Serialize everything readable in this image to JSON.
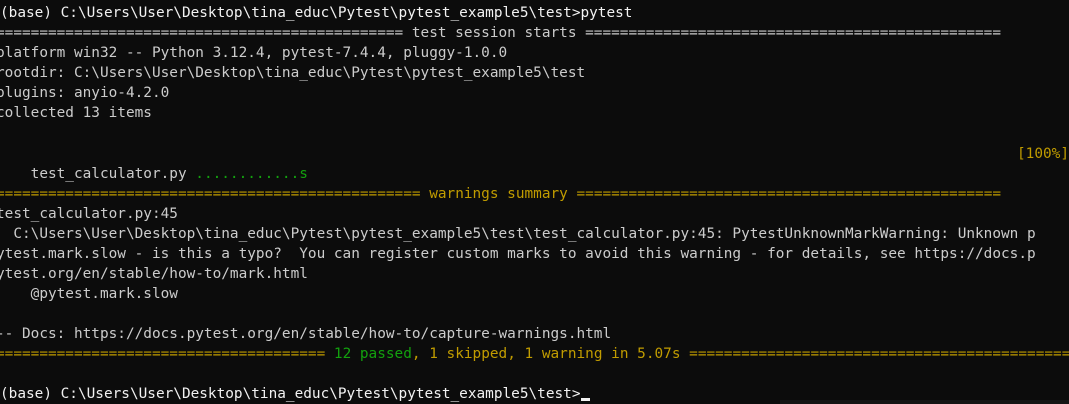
{
  "terminal": {
    "prompt1": "(base) C:\\Users\\User\\Desktop\\tina_educ\\Pytest\\pytest_example5\\test>pytest",
    "session_rule": "=============================================== test session starts ================================================",
    "platform": "platform win32 -- Python 3.12.4, pytest-7.4.4, pluggy-1.0.0",
    "rootdir": "rootdir: C:\\Users\\User\\Desktop\\tina_educ\\Pytest\\pytest_example5\\test",
    "plugins": "plugins: anyio-4.2.0",
    "collected": "collected 13 items",
    "result_file": "test_calculator.py ",
    "result_dots": "............s",
    "result_percent": "[100%]",
    "warnings_rule_left": "================================================= ",
    "warnings_rule_title": "warnings summary",
    "warnings_rule_right": " =================================================",
    "warning_location": "test_calculator.py:45",
    "warning_detail_1": "  C:\\Users\\User\\Desktop\\tina_educ\\Pytest\\pytest_example5\\test\\test_calculator.py:45: PytestUnknownMarkWarning: Unknown p",
    "warning_detail_2": "ytest.mark.slow - is this a typo?  You can register custom marks to avoid this warning - for details, see https://docs.p",
    "warning_detail_3": "ytest.org/en/stable/how-to/mark.html",
    "warning_detail_4": "    @pytest.mark.slow",
    "docs_line": "-- Docs: https://docs.pytest.org/en/stable/how-to/capture-warnings.html",
    "summary_rule_left": "====================================== ",
    "summary_passed": "12 passed",
    "summary_sep1": ", ",
    "summary_skipped": "1 skipped",
    "summary_sep2": ", ",
    "summary_warning": "1 warning",
    "summary_time": " in 5.07s ",
    "summary_rule_right": "=================================================",
    "prompt2": "(base) C:\\Users\\User\\Desktop\\tina_educ\\Pytest\\pytest_example5\\test>",
    "colors": {
      "background": "#0c0c0c",
      "text": "#cccccc",
      "bright_text": "#f2f2f2",
      "green": "#13a10e",
      "yellow": "#c19c00"
    }
  }
}
